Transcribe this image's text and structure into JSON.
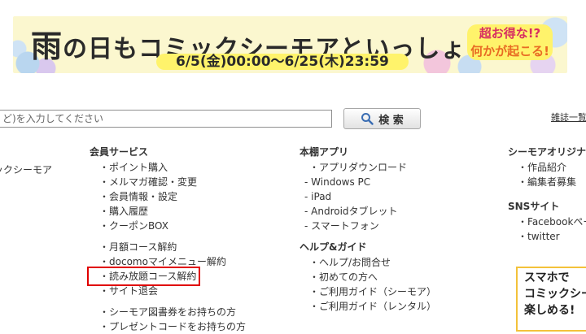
{
  "banner": {
    "title_head": "雨",
    "title_rest": "の日もコミックシーモアといっしょ",
    "dates": "6/5(金)00:00～6/25(木)23:59",
    "sub_line1": "超お得な!?",
    "sub_line2": "何かが起こる!"
  },
  "search": {
    "placeholder": "ど)を入力してください",
    "button_label": "検 索"
  },
  "top_right_link": "雑誌一覧",
  "columns": {
    "col0": {
      "item": "ックシーモア"
    },
    "member": {
      "heading": "会員サービス",
      "group1": [
        "ポイント購入",
        "メルマガ確認・変更",
        "会員情報・設定",
        "購入履歴",
        "クーポンBOX"
      ],
      "group2": [
        "月額コース解約",
        "docomoマイメニュー解約",
        "読み放題コース解約",
        "サイト退会"
      ],
      "group3": [
        "シーモア図書券をお持ちの方",
        "プレゼントコードをお持ちの方"
      ]
    },
    "app": {
      "heading": "本棚アプリ",
      "download": "アプリダウンロード",
      "platforms": [
        "Windows PC",
        "iPad",
        "Androidタブレット",
        "スマートフォン"
      ]
    },
    "help": {
      "heading": "ヘルプ&ガイド",
      "items": [
        "ヘルプ/お問合せ",
        "初めての方へ",
        "ご利用ガイド（シーモア）",
        "ご利用ガイド（レンタル）"
      ]
    },
    "original": {
      "heading": "シーモアオリジナル",
      "items": [
        "作品紹介",
        "編集者募集"
      ]
    },
    "sns": {
      "heading": "SNSサイト",
      "items": [
        "Facebookページ",
        "twitter"
      ]
    }
  },
  "promo": {
    "line1": "スマホで",
    "line2": "コミックシー",
    "line3": "楽しめる!"
  },
  "colors": {
    "banner_bg": "#fbf7cf",
    "banner_accent": "#fff36b",
    "highlight_box": "#e00000",
    "promo_border": "#f3c23a"
  }
}
